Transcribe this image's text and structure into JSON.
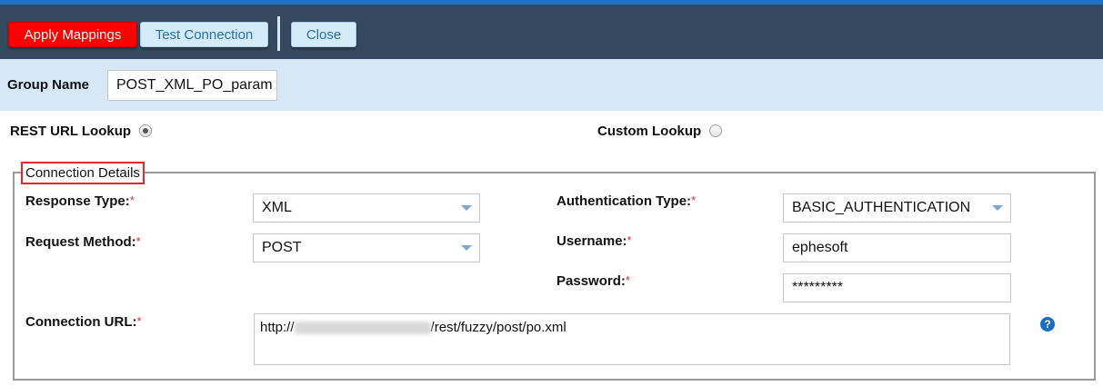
{
  "toolbar": {
    "apply_label": "Apply Mappings",
    "test_label": "Test Connection",
    "close_label": "Close"
  },
  "group": {
    "label": "Group Name",
    "value": "POST_XML_PO_param"
  },
  "lookup": {
    "rest_label": "REST URL Lookup",
    "rest_selected": true,
    "custom_label": "Custom Lookup",
    "custom_selected": false
  },
  "connection": {
    "legend": "Connection Details",
    "response_type": {
      "label": "Response Type:",
      "value": "XML"
    },
    "request_method": {
      "label": "Request Method:",
      "value": "POST"
    },
    "auth_type": {
      "label": "Authentication Type:",
      "value": "BASIC_AUTHENTICATION"
    },
    "username": {
      "label": "Username:",
      "value": "ephesoft"
    },
    "password": {
      "label": "Password:",
      "value": "*********"
    },
    "url": {
      "label": "Connection URL:",
      "prefix": "http://",
      "suffix": "/rest/fuzzy/post/po.xml"
    },
    "required_mark": "*",
    "help_glyph": "?"
  },
  "colors": {
    "accent_red": "#ff0000",
    "toolbar_bg": "#34495e",
    "group_bg": "#d6e7f5",
    "help_blue": "#1b6dc1"
  }
}
